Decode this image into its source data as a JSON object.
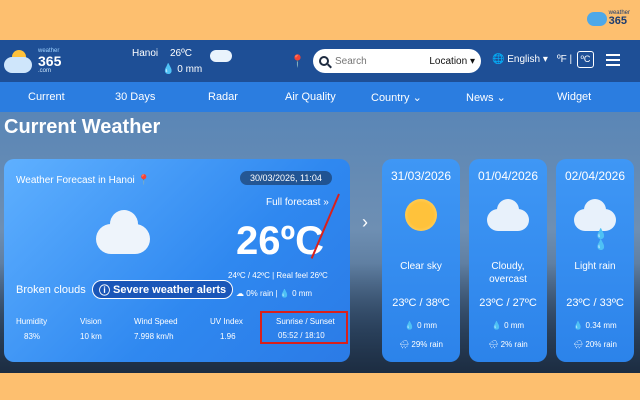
{
  "frame_logo": {
    "line1": "weather",
    "line2": "365"
  },
  "header": {
    "brand_top": "weather",
    "brand_name": "365",
    "brand_sub": ".com",
    "city": "Hanoi",
    "temp": "26ºC",
    "rain": "0 mm",
    "search_placeholder": "Search",
    "location_label": "Location",
    "language": "English",
    "unit_f": "ºF |",
    "unit_c": "ºC"
  },
  "nav": [
    "Current",
    "30 Days",
    "Radar",
    "Air Quality",
    "Country",
    "News",
    "Widget"
  ],
  "page_title": "Current Weather",
  "current": {
    "forecast_label": "Weather Forecast in Hanoi",
    "datetime": "30/03/2026, 11:04",
    "full_forecast": "Full forecast »",
    "temp": "26ºC",
    "minmax": "24ºC / 42ºC | Real feel 26ºC",
    "rain_pct": "0% rain",
    "rain_mm": "0 mm",
    "description": "Broken clouds",
    "alert": "Severe weather alerts",
    "stats": [
      {
        "label": "Humidity",
        "value": "83%"
      },
      {
        "label": "Vision",
        "value": "10 km"
      },
      {
        "label": "Wind Speed",
        "value": "7.998 km/h"
      },
      {
        "label": "UV Index",
        "value": "1.96"
      }
    ],
    "sun_label": "Sunrise / Sunset",
    "sun_value": "05:52  /  18:10"
  },
  "days": [
    {
      "date": "31/03/2026",
      "icon": "sun-icon",
      "cond": "Clear sky",
      "temps": "23ºC / 38ºC",
      "rain_mm": "0 mm",
      "rain_pct": "29% rain"
    },
    {
      "date": "01/04/2026",
      "icon": "cloud-icon",
      "cond": "Cloudy, overcast",
      "temps": "23ºC / 27ºC",
      "rain_mm": "0 mm",
      "rain_pct": "2% rain"
    },
    {
      "date": "02/04/2026",
      "icon": "rain-cloud-icon",
      "cond": "Light rain",
      "temps": "23ºC / 33ºC",
      "rain_mm": "0.34 mm",
      "rain_pct": "20% rain"
    }
  ]
}
